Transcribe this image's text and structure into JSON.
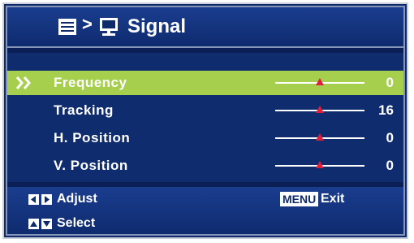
{
  "header": {
    "menu_icon": "menu-list-icon",
    "separator": ">",
    "monitor_icon": "monitor-icon",
    "title": "Signal"
  },
  "items": [
    {
      "label": "Frequency",
      "value": "0",
      "level": 0.5,
      "selected": true
    },
    {
      "label": "Tracking",
      "value": "16",
      "level": 0.5,
      "selected": false
    },
    {
      "label": "H. Position",
      "value": "0",
      "level": 0.5,
      "selected": false
    },
    {
      "label": "V. Position",
      "value": "0",
      "level": 0.5,
      "selected": false
    }
  ],
  "footer": {
    "adjust_label": "Adjust",
    "select_label": "Select",
    "menu_key": "MENU",
    "exit_label": "Exit"
  },
  "colors": {
    "background": "#0e2a6a",
    "highlight": "#a5cf4c",
    "handle": "#e0203a",
    "text": "#ffffff"
  }
}
